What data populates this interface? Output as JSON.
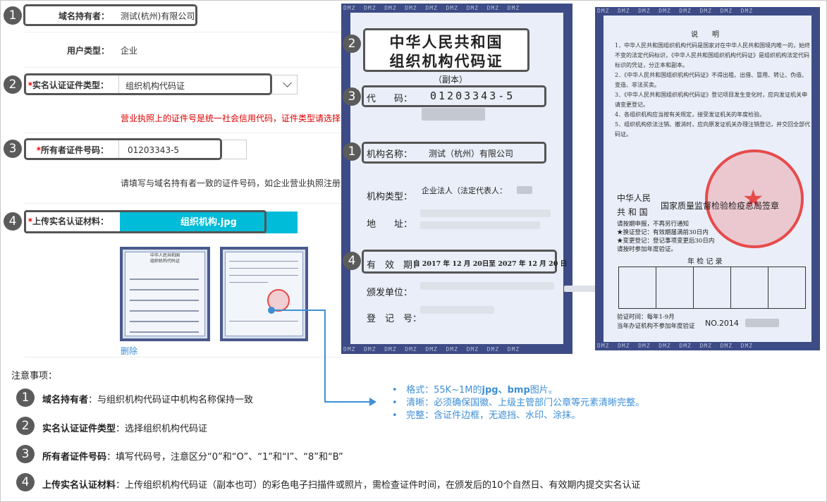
{
  "form": {
    "holder": {
      "label": "域名持有者：",
      "value": "测试(杭州)有限公司"
    },
    "user_type": {
      "label": "用户类型：",
      "value": "企业"
    },
    "cert_type": {
      "star": "*",
      "label": "实名认证证件类型：",
      "value": "组织机构代码证"
    },
    "cert_type_warning": "营业执照上的证件号是统一社会信用代码，证件类型请选择",
    "cert_no": {
      "star": "*",
      "label": "所有者证件号码：",
      "value": "01203343-5"
    },
    "cert_no_hint": "请填写与域名持有者一致的证件号码，如企业营业执照注册",
    "upload": {
      "star": "*",
      "label": "上传实名认证材料：",
      "file": "组织机构.jpg"
    },
    "delete_link": "删除",
    "thumb_title": "中华人民共和国\n组织机构代码证"
  },
  "markers": [
    "1",
    "2",
    "3",
    "4"
  ],
  "certificate": {
    "title_line1": "中华人民共和国",
    "title_line2": "组织机构代码证",
    "copy": "（副本）",
    "code_label": "代　　码：",
    "code_value": "01203343-5",
    "name_label": "机构名称：",
    "name_value": "测试（杭州）有限公司",
    "type_label": "机构类型：",
    "type_value": "企业法人（法定代表人：",
    "addr_label": "地　　址：",
    "valid_label": "有　效　期：",
    "valid_value": "自 2017 年 12 月 20日至 2027 年 12 月 20 日",
    "issuer_label": "颁发单位：",
    "reg_label": "登　记　号：",
    "dmz": "DMZ"
  },
  "certificate_back": {
    "heading": "说　　明",
    "items": [
      "1．中华人民共和国组织机构代码是国家对在中华人民共和国境内唯一的，始终不变的法定代码标识，《中华人民共和国组织机构代码证》是组织机构法定代码标识的凭证，分正本和副本。",
      "2．《中华人民共和国组织机构代码证》不得出租、出借、冒用、转让、伪造、变造、非法买卖。",
      "3．《中华人民共和国组织机构代码证》登记项目发生变化时，应向发证机关申请变更登记。",
      "4．各组织机构应当按有关规定，接受发证机关的年度检验。",
      "5．组织机构依法注销、撤消时，应向原发证机关办理注销登记，并交回全部代码证。"
    ],
    "country1": "中华人民",
    "country2": "共 和 国",
    "authority": "国家质量监督检验检疫总局签章",
    "notes": [
      "请按期申报，不再另行通知",
      "★换证登记：有效期届满前30日内",
      "★变更登记：登记事项变更后30日内",
      "请按时参加年度验证。"
    ],
    "annual": "年 检 记 录",
    "verify": "验证时间：每年1-9月",
    "unverified": "当年办证机构不参加年度验证",
    "no": "NO.2014"
  },
  "notes_title": "注意事项：",
  "notes": [
    {
      "n": "1",
      "term": "域名持有者",
      "text": "：与组织机构代码证中机构名称保持一致"
    },
    {
      "n": "2",
      "term": "实名认证证件类型",
      "text": "：选择组织机构代码证"
    },
    {
      "n": "3",
      "term": "所有者证件号码",
      "text": "：填写代码号，注意区分“0”和“O”、“1”和“I”、“8”和“B”"
    },
    {
      "n": "4",
      "term": "上传实名认证材料",
      "text": "：上传组织机构代码证（副本也可）的彩色电子扫描件或照片，需检查证件时间，在颁发后的10个自然日、有效期内提交实名认证"
    }
  ],
  "requirements": [
    {
      "a": "格式：55K~1M的",
      "b": "jpg、bmp",
      "c": "图片。"
    },
    {
      "a": "清晰：必须确保国徽、上级主管部门公章等元素清晰完整。",
      "b": "",
      "c": ""
    },
    {
      "a": "完整：含证件边框，无遮挡、水印、涂抹。",
      "b": "",
      "c": ""
    }
  ],
  "colors": {
    "accent": "#00bcd8",
    "marker": "#5b5b5b",
    "link": "#3d8fd6",
    "warning": "#e00000",
    "stamp": "#e64b4b"
  }
}
